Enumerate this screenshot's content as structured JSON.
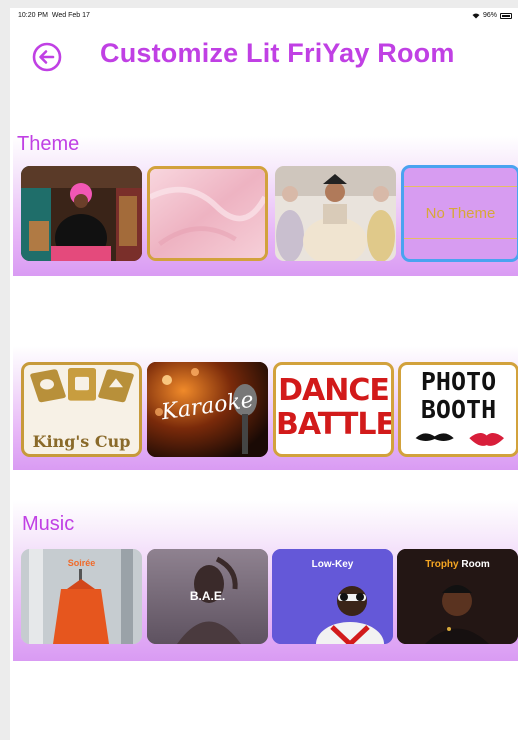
{
  "status_bar": {
    "time": "10:20 PM",
    "date": "Wed Feb 17",
    "battery": "96%"
  },
  "header": {
    "title": "Customize Lit FriYay Room",
    "back_icon": "arrow-left-circle-icon"
  },
  "theme": {
    "title": "Theme",
    "tiles": [
      {
        "name": "theme-pink-hair-room"
      },
      {
        "name": "theme-pink-silk"
      },
      {
        "name": "theme-baroque-queen"
      },
      {
        "name": "theme-none",
        "label": "No Theme",
        "selected": true
      }
    ]
  },
  "games": {
    "tiles": [
      {
        "name": "game-kings-cup",
        "label": "King's Cup"
      },
      {
        "name": "game-karaoke",
        "label": "Karaoke"
      },
      {
        "name": "game-dance-battle",
        "line1": "DANCE",
        "line2": "BATTLE"
      },
      {
        "name": "game-photo-booth",
        "line1": "PHOTO",
        "line2": "BOOTH"
      }
    ]
  },
  "music": {
    "title": "Music",
    "tiles": [
      {
        "name": "music-soiree",
        "label": "Soirée"
      },
      {
        "name": "music-bae",
        "label": "B.A.E."
      },
      {
        "name": "music-low-key",
        "label": "Low-Key"
      },
      {
        "name": "music-trophy-room",
        "label_a": "Trophy",
        "label_b": " Room"
      }
    ]
  },
  "colors": {
    "accent": "#c040e4",
    "selected_border": "#4aa3f0",
    "tile_border": "#d2a23c"
  }
}
